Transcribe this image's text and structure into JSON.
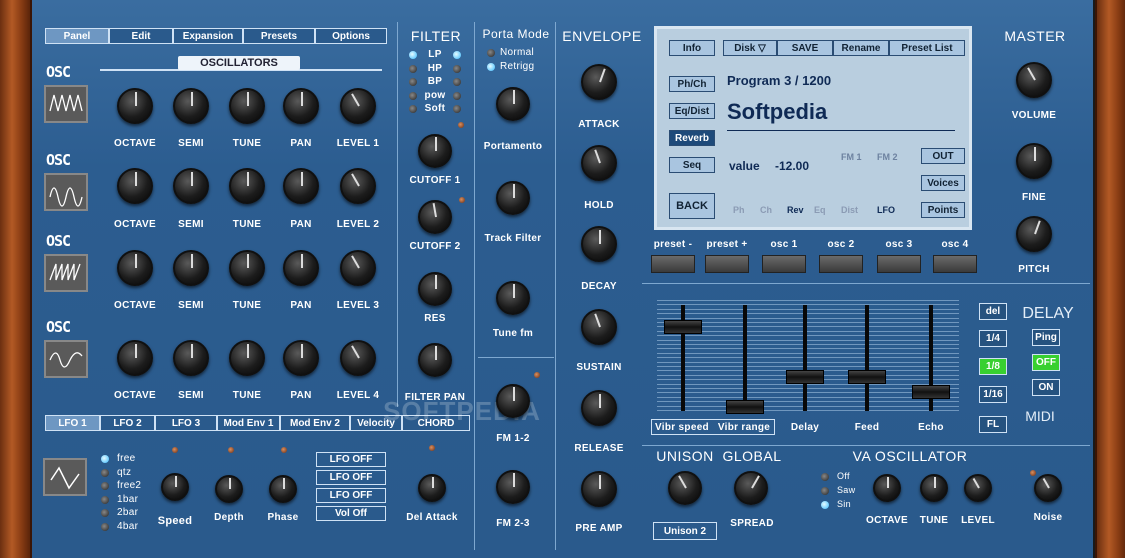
{
  "tabs": [
    "Panel",
    "Edit",
    "Expansion",
    "Presets",
    "Options"
  ],
  "oscillators": {
    "title": "OSCILLATORS",
    "rows": [
      {
        "osc": "OSC",
        "labels": [
          "OCTAVE",
          "SEMI",
          "TUNE",
          "PAN",
          "LEVEL 1"
        ]
      },
      {
        "osc": "OSC",
        "labels": [
          "OCTAVE",
          "SEMI",
          "TUNE",
          "PAN",
          "LEVEL 2"
        ]
      },
      {
        "osc": "OSC",
        "labels": [
          "OCTAVE",
          "SEMI",
          "TUNE",
          "PAN",
          "LEVEL 3"
        ]
      },
      {
        "osc": "OSC",
        "labels": [
          "OCTAVE",
          "SEMI",
          "TUNE",
          "PAN",
          "LEVEL 4"
        ]
      }
    ]
  },
  "lfo_tabs": [
    "LFO 1",
    "LFO 2",
    "LFO 3",
    "Mod Env 1",
    "Mod Env 2",
    "Velocity",
    "CHORD"
  ],
  "lfo": {
    "modes": [
      "free",
      "qtz",
      "free2",
      "1bar",
      "2bar",
      "4bar"
    ],
    "knobs": [
      "Speed",
      "Depth",
      "Phase"
    ],
    "toggles": [
      "LFO OFF",
      "LFO OFF",
      "LFO OFF",
      "Vol Off"
    ],
    "del_attack": "Del Attack"
  },
  "filter": {
    "title": "FILTER",
    "types": [
      "LP",
      "HP",
      "BP",
      "pow",
      "Soft"
    ],
    "knobs": [
      "CUTOFF 1",
      "CUTOFF 2",
      "RES",
      "FILTER PAN"
    ]
  },
  "porta": {
    "title": "Porta Mode",
    "modes": [
      "Normal",
      "Retrigg"
    ],
    "knobs": [
      "Portamento",
      "Track Filter",
      "Tune fm",
      "FM 1-2",
      "FM 2-3"
    ]
  },
  "envelope": {
    "title": "ENVELOPE",
    "knobs": [
      "ATTACK",
      "HOLD",
      "DECAY",
      "SUSTAIN",
      "RELEASE",
      "PRE AMP"
    ]
  },
  "lcd": {
    "top_buttons": [
      "Info",
      "Disk",
      "SAVE",
      "Rename",
      "Preset List"
    ],
    "side_buttons": [
      "Ph/Ch",
      "Eq/Dist",
      "Reverb",
      "Seq",
      "BACK"
    ],
    "program": "Program 3 / 1200",
    "preset_name": "Softpedia",
    "value_label": "value",
    "value": "-12.00",
    "fm": [
      "FM 1",
      "FM 2"
    ],
    "right_buttons": [
      "OUT",
      "Voices",
      "Points"
    ],
    "bottom_tabs": [
      "Ph",
      "Ch",
      "Rev",
      "Eq",
      "Dist",
      "LFO"
    ]
  },
  "preset_slots": [
    "preset -",
    "preset +",
    "osc 1",
    "osc 2",
    "osc 3",
    "osc 4"
  ],
  "faders": {
    "labels": [
      "Vibr speed",
      "Vibr range",
      "Delay",
      "Feed",
      "Echo"
    ],
    "levels": [
      0.85,
      0.05,
      0.35,
      0.35,
      0.2
    ]
  },
  "delay": {
    "title": "DELAY",
    "buttons": [
      "del",
      "1/4",
      "1/8",
      "1/16",
      "FL"
    ],
    "modes": [
      "Ping",
      "OFF",
      "ON"
    ],
    "midi": "MIDI"
  },
  "master": {
    "title": "MASTER",
    "knobs": [
      "VOLUME",
      "FINE",
      "PITCH"
    ]
  },
  "unison": {
    "title": "UNISON",
    "button": "Unison 2"
  },
  "global": {
    "title": "GLOBAL",
    "knob": "SPREAD"
  },
  "va": {
    "title": "VA OSCILLATOR",
    "waves": [
      "Off",
      "Saw",
      "Sin"
    ],
    "knobs": [
      "OCTAVE",
      "TUNE",
      "LEVEL"
    ],
    "noise": "Noise"
  },
  "watermark": "SOFTPEDIA"
}
